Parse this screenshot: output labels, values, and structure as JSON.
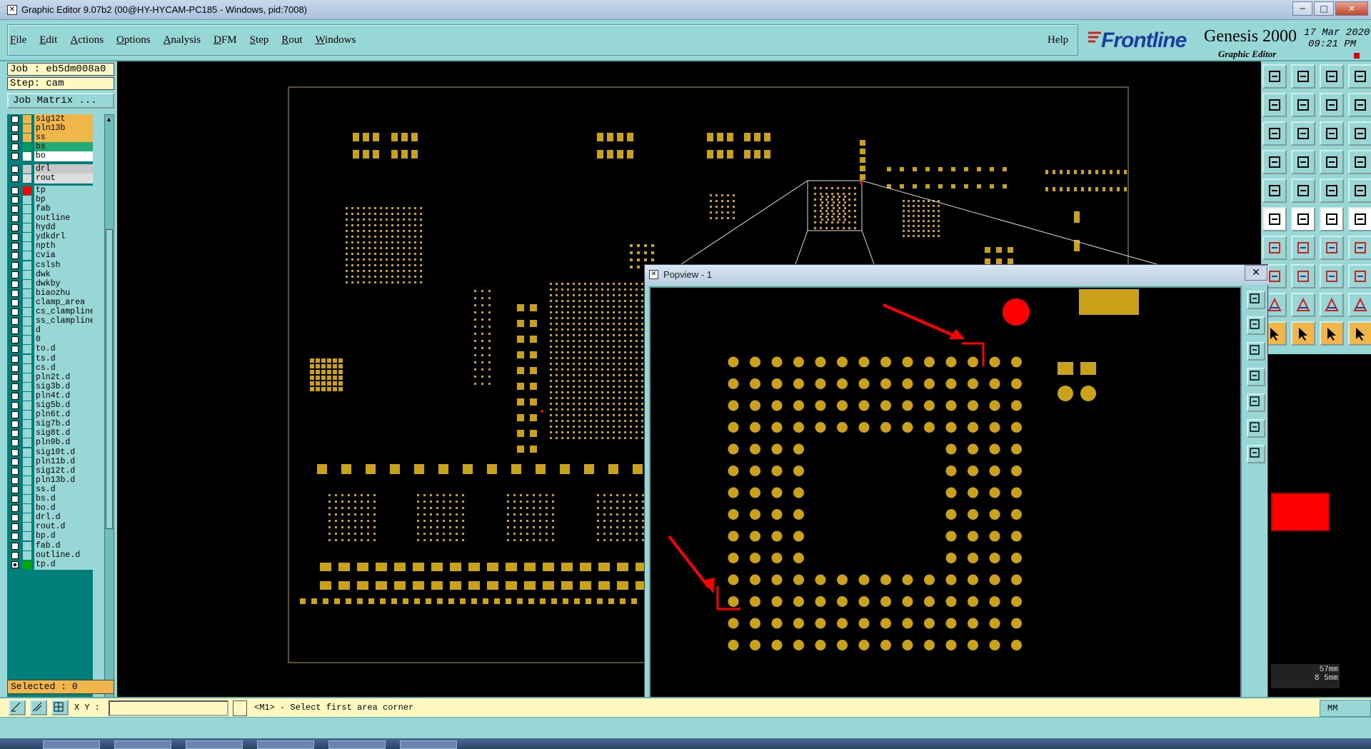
{
  "window": {
    "title": "Graphic Editor 9.07b2 (00@HY-HYCAM-PC185 - Windows, pid:7008)",
    "icon": "x-icon",
    "controls": [
      "─",
      "□",
      "✕"
    ]
  },
  "menu": {
    "items": [
      {
        "first": "F",
        "rest": "ile"
      },
      {
        "first": "E",
        "rest": "dit"
      },
      {
        "first": "A",
        "rest": "ctions"
      },
      {
        "first": "O",
        "rest": "ptions"
      },
      {
        "first": "A",
        "rest": "nalysis"
      },
      {
        "first": "D",
        "rest": "FM"
      },
      {
        "first": "S",
        "rest": "tep"
      },
      {
        "first": "R",
        "rest": "out"
      },
      {
        "first": "W",
        "rest": "indows"
      }
    ],
    "help": "Help"
  },
  "brand": {
    "logo": "Frontline",
    "product": "Genesis 2000",
    "subproduct": "Graphic Editor",
    "date": "17 Mar 2020",
    "time": "09:21 PM"
  },
  "left": {
    "job": "Job : eb5dm008a0",
    "step": "Step: cam",
    "job_matrix": "Job Matrix ...",
    "selected": "Selected : 0",
    "layers": [
      {
        "name": "sig12t",
        "color": "#f0b64a",
        "bg": "#f0b64a",
        "checked": false
      },
      {
        "name": "pln13b",
        "color": "#f0b64a",
        "bg": "#f0b64a",
        "checked": false
      },
      {
        "name": "ss",
        "color": "#f0b64a",
        "bg": "#f0b64a",
        "checked": false
      },
      {
        "name": "bs",
        "color": "#009966",
        "bg": "#22aa77",
        "checked": false
      },
      {
        "name": "bo",
        "color": "#ffffff",
        "bg": "#ffffff",
        "checked": false
      },
      {
        "name": "drl",
        "color": "#c8c8c8",
        "bg": "#c8c8c8",
        "checked": false,
        "gap": true
      },
      {
        "name": "rout",
        "color": "#dddddd",
        "bg": "#dddddd",
        "checked": false
      },
      {
        "name": "tp",
        "color": "#ff0000",
        "bg": "#97d8d6",
        "checked": false,
        "gap": true
      },
      {
        "name": "bp",
        "color": "#97d8d6",
        "bg": "#97d8d6",
        "checked": false
      },
      {
        "name": "fab",
        "color": "#97d8d6",
        "bg": "#97d8d6",
        "checked": false
      },
      {
        "name": "outline",
        "color": "#97d8d6",
        "bg": "#97d8d6",
        "checked": false
      },
      {
        "name": "hydd",
        "color": "#97d8d6",
        "bg": "#97d8d6",
        "checked": false
      },
      {
        "name": "ydkdrl",
        "color": "#97d8d6",
        "bg": "#97d8d6",
        "checked": false
      },
      {
        "name": "npth",
        "color": "#97d8d6",
        "bg": "#97d8d6",
        "checked": false
      },
      {
        "name": "cvia",
        "color": "#97d8d6",
        "bg": "#97d8d6",
        "checked": false
      },
      {
        "name": "cslsh",
        "color": "#97d8d6",
        "bg": "#97d8d6",
        "checked": false
      },
      {
        "name": "dwk",
        "color": "#97d8d6",
        "bg": "#97d8d6",
        "checked": false
      },
      {
        "name": "dwkby",
        "color": "#97d8d6",
        "bg": "#97d8d6",
        "checked": false
      },
      {
        "name": "biaozhu",
        "color": "#97d8d6",
        "bg": "#97d8d6",
        "checked": false
      },
      {
        "name": "clamp_area",
        "color": "#97d8d6",
        "bg": "#97d8d6",
        "checked": false
      },
      {
        "name": "cs_clampline",
        "color": "#97d8d6",
        "bg": "#97d8d6",
        "checked": false
      },
      {
        "name": "ss_clampline",
        "color": "#97d8d6",
        "bg": "#97d8d6",
        "checked": false
      },
      {
        "name": "d",
        "color": "#97d8d6",
        "bg": "#97d8d6",
        "checked": false
      },
      {
        "name": "0",
        "color": "#97d8d6",
        "bg": "#97d8d6",
        "checked": false
      },
      {
        "name": "to.d",
        "color": "#97d8d6",
        "bg": "#97d8d6",
        "checked": false
      },
      {
        "name": "ts.d",
        "color": "#97d8d6",
        "bg": "#97d8d6",
        "checked": false
      },
      {
        "name": "cs.d",
        "color": "#97d8d6",
        "bg": "#97d8d6",
        "checked": false
      },
      {
        "name": "pln2t.d",
        "color": "#97d8d6",
        "bg": "#97d8d6",
        "checked": false
      },
      {
        "name": "sig3b.d",
        "color": "#97d8d6",
        "bg": "#97d8d6",
        "checked": false
      },
      {
        "name": "pln4t.d",
        "color": "#97d8d6",
        "bg": "#97d8d6",
        "checked": false
      },
      {
        "name": "sig5b.d",
        "color": "#97d8d6",
        "bg": "#97d8d6",
        "checked": false
      },
      {
        "name": "pln6t.d",
        "color": "#97d8d6",
        "bg": "#97d8d6",
        "checked": false
      },
      {
        "name": "sig7b.d",
        "color": "#97d8d6",
        "bg": "#97d8d6",
        "checked": false
      },
      {
        "name": "sig8t.d",
        "color": "#97d8d6",
        "bg": "#97d8d6",
        "checked": false
      },
      {
        "name": "pln9b.d",
        "color": "#97d8d6",
        "bg": "#97d8d6",
        "checked": false
      },
      {
        "name": "sig10t.d",
        "color": "#97d8d6",
        "bg": "#97d8d6",
        "checked": false
      },
      {
        "name": "pln11b.d",
        "color": "#97d8d6",
        "bg": "#97d8d6",
        "checked": false
      },
      {
        "name": "sig12t.d",
        "color": "#97d8d6",
        "bg": "#97d8d6",
        "checked": false
      },
      {
        "name": "pln13b.d",
        "color": "#97d8d6",
        "bg": "#97d8d6",
        "checked": false
      },
      {
        "name": "ss.d",
        "color": "#97d8d6",
        "bg": "#97d8d6",
        "checked": false
      },
      {
        "name": "bs.d",
        "color": "#97d8d6",
        "bg": "#97d8d6",
        "checked": false
      },
      {
        "name": "bo.d",
        "color": "#97d8d6",
        "bg": "#97d8d6",
        "checked": false
      },
      {
        "name": "drl.d",
        "color": "#97d8d6",
        "bg": "#97d8d6",
        "checked": false
      },
      {
        "name": "rout.d",
        "color": "#97d8d6",
        "bg": "#97d8d6",
        "checked": false
      },
      {
        "name": "bp.d",
        "color": "#97d8d6",
        "bg": "#97d8d6",
        "checked": false
      },
      {
        "name": "fab.d",
        "color": "#97d8d6",
        "bg": "#97d8d6",
        "checked": false
      },
      {
        "name": "outline.d",
        "color": "#97d8d6",
        "bg": "#97d8d6",
        "checked": false
      },
      {
        "name": "tp.d",
        "color": "#00aa00",
        "bg": "#97d8d6",
        "checked": true
      }
    ]
  },
  "command": {
    "xy_label": "X Y :",
    "xy_value": "",
    "prompt": "<M1> - Select first area corner",
    "units": "MM"
  },
  "units_readout": [
    "57mm",
    "8 5mm"
  ],
  "popview": {
    "title": "Popview - 1",
    "close": "✕"
  },
  "colors": {
    "pad": "#c9a21a",
    "panel": "#97d8d6",
    "accent_red": "#ff0000",
    "board_outline": "#b8a050"
  }
}
